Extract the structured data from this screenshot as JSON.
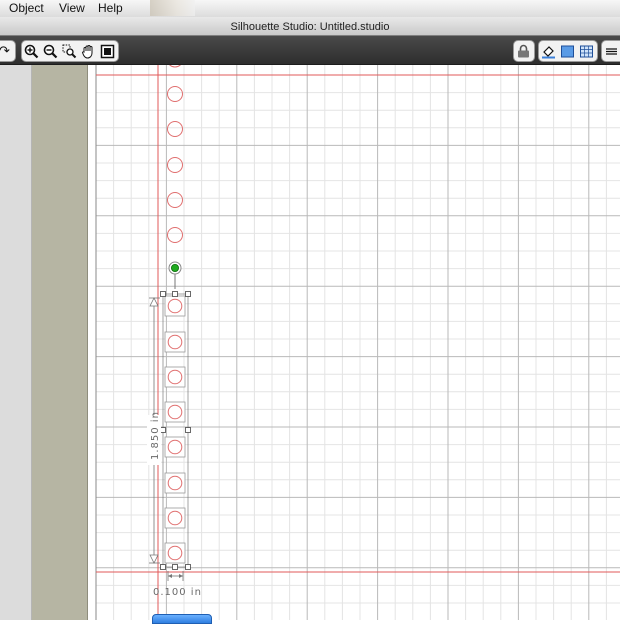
{
  "menu": {
    "object": "Object",
    "view": "View",
    "help": "Help"
  },
  "window": {
    "title": "Silhouette Studio: Untitled.studio"
  },
  "toolbar": {
    "left_tools": [
      "redo-icon",
      "zoom-in-icon",
      "zoom-out-icon",
      "zoom-select-icon",
      "pan-hand-icon",
      "fit-page-icon"
    ],
    "right_tools": [
      "lock-icon",
      "fill-icon",
      "page-view-icon",
      "grid-view-icon",
      "menu-lines-icon"
    ]
  },
  "selection": {
    "height_label": "1.850 in",
    "width_label": "0.100 in"
  },
  "colors": {
    "guide": "#e05a5a",
    "shape": "#e06f6f",
    "grid_minor": "#e4e4e4",
    "grid_major": "#b9b9b9",
    "rotate_handle": "#1faa1f"
  }
}
